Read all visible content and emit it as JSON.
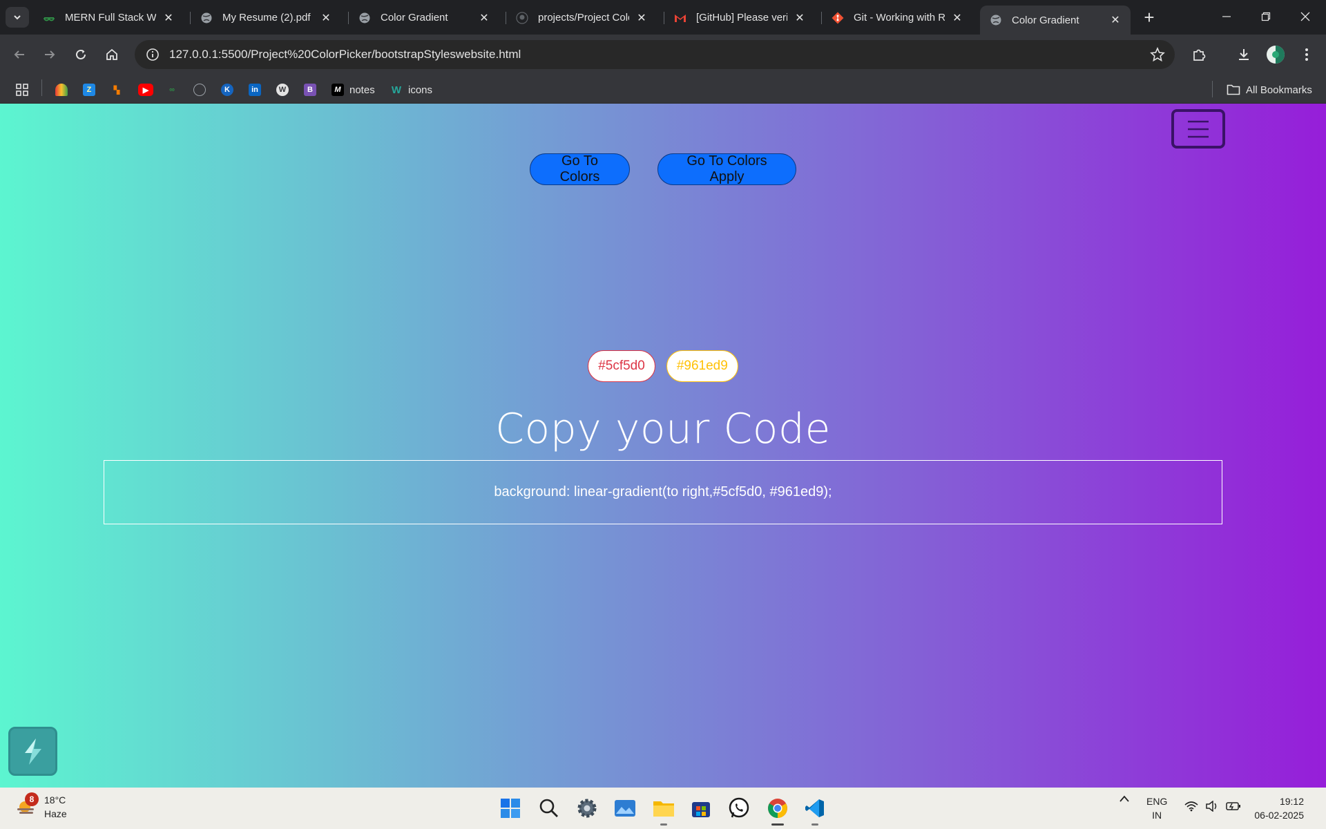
{
  "browser": {
    "tabs": [
      {
        "title": "MERN Full Stack Web",
        "icon": "geeksforgeeks-icon",
        "active": false
      },
      {
        "title": "My Resume (2).pdf",
        "icon": "globe-icon",
        "active": false
      },
      {
        "title": "Color Gradient",
        "icon": "globe-icon",
        "active": false
      },
      {
        "title": "projects/Project Colo",
        "icon": "github-icon",
        "active": false
      },
      {
        "title": "[GitHub] Please verify",
        "icon": "gmail-icon",
        "active": false
      },
      {
        "title": "Git - Working with Re",
        "icon": "git-icon",
        "active": false
      },
      {
        "title": "Color Gradient",
        "icon": "globe-icon",
        "active": true
      }
    ],
    "url": "127.0.0.1:5500/Project%20ColorPicker/bootstrapStyleswebsite.html",
    "bookmarks": [
      {
        "label": "notes",
        "icon": "medium-icon"
      },
      {
        "label": "icons",
        "icon": "w-icon"
      }
    ],
    "all_bookmarks_label": "All Bookmarks"
  },
  "page": {
    "gradient": {
      "from": "#5cf5d0",
      "to": "#961ed9"
    },
    "nav_buttons": [
      "Go To Colors",
      "Go To Colors Apply"
    ],
    "color_chips": [
      "#5cf5d0",
      "#961ed9"
    ],
    "heading": "Copy your Code",
    "code": "background: linear-gradient(to right,#5cf5d0, #961ed9);"
  },
  "taskbar": {
    "weather": {
      "temp": "18°C",
      "condition": "Haze",
      "badge": "8"
    },
    "language": {
      "line1": "ENG",
      "line2": "IN"
    },
    "time": "19:12",
    "date": "06-02-2025"
  }
}
